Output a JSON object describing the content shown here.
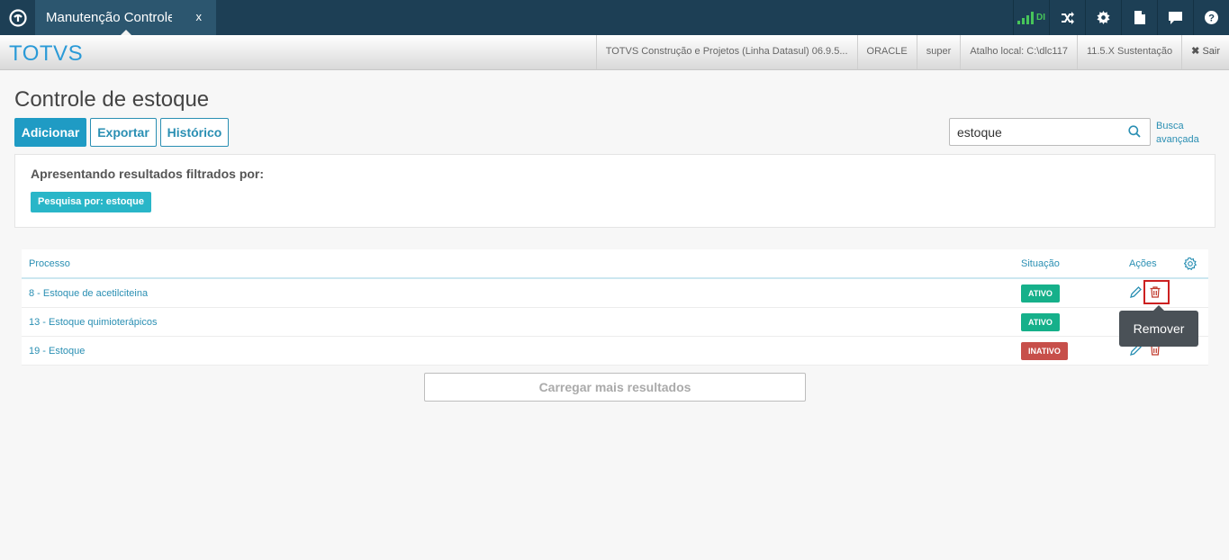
{
  "topbar": {
    "tab_title": "Manutenção Controle de Estoque",
    "tab_close": "x",
    "signal_label": "DI",
    "icons": [
      "totvs-logo-icon",
      "shuffle-icon",
      "gear-icon",
      "document-icon",
      "chat-icon",
      "help-icon"
    ]
  },
  "header": {
    "brand": "TOTVS",
    "product": "TOTVS Construção e Projetos (Linha Datasul) 06.9.5...",
    "database": "ORACLE",
    "user": "super",
    "shortcut": "Atalho local: C:\\dlc117",
    "version": "11.5.X Sustentação",
    "logout": "Sair"
  },
  "page": {
    "title": "Controle de estoque",
    "add_label": "Adicionar",
    "export_label": "Exportar",
    "history_label": "Histórico",
    "search_value": "estoque",
    "advanced_line1": "Busca",
    "advanced_line2": "avançada"
  },
  "filter": {
    "title": "Apresentando resultados filtrados por:",
    "tag": "Pesquisa por: estoque"
  },
  "table": {
    "headers": {
      "process": "Processo",
      "status": "Situação",
      "actions": "Ações"
    },
    "rows": [
      {
        "process": "8 - Estoque de acetilciteina",
        "status": "ATIVO"
      },
      {
        "process": "13 - Estoque quimioterápicos",
        "status": "ATIVO"
      },
      {
        "process": "19 - Estoque",
        "status": "INATIVO"
      }
    ]
  },
  "tooltip": "Remover",
  "load_more": "Carregar mais resultados",
  "colors": {
    "topbar": "#1d3f55",
    "accent": "#2a8fb3",
    "active": "#16b08a",
    "inactive": "#c74f4a",
    "highlight": "#cc2020"
  }
}
